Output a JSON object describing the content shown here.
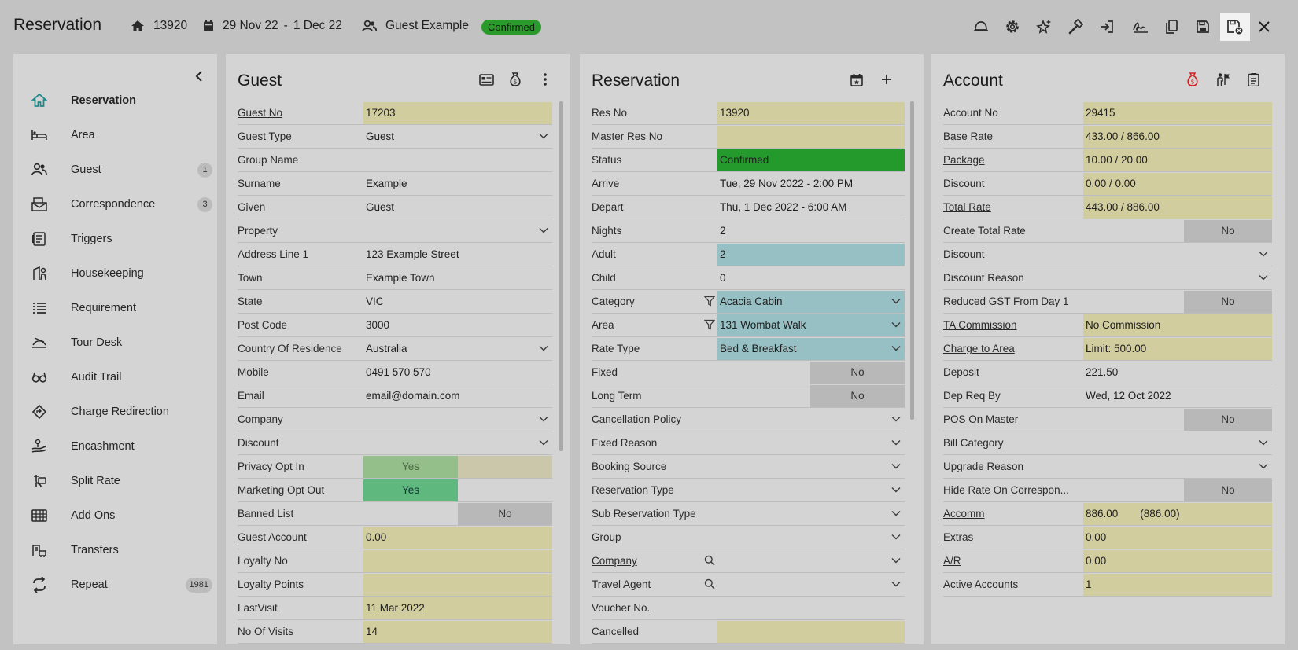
{
  "header": {
    "title": "Reservation",
    "res_no": "13920",
    "date_from": "29 Nov 22",
    "date_sep": "-",
    "date_to": "1 Dec 22",
    "guest_name": "Guest Example",
    "status": "Confirmed"
  },
  "toolbar_icons": [
    "bell-icon",
    "settings-icon",
    "magic-icon",
    "hammer-icon",
    "check-in-icon",
    "signature-icon",
    "copy-icon",
    "save-icon",
    "save-close-icon",
    "close-icon"
  ],
  "sidebar": {
    "items": [
      {
        "label": "Reservation",
        "icon": "home-icon",
        "active": true
      },
      {
        "label": "Area",
        "icon": "bed-icon"
      },
      {
        "label": "Guest",
        "icon": "people-icon",
        "count": "1"
      },
      {
        "label": "Correspondence",
        "icon": "correspondence-icon",
        "count": "3"
      },
      {
        "label": "Triggers",
        "icon": "triggers-icon"
      },
      {
        "label": "Housekeeping",
        "icon": "housekeeping-icon"
      },
      {
        "label": "Requirement",
        "icon": "list-icon"
      },
      {
        "label": "Tour Desk",
        "icon": "tour-icon"
      },
      {
        "label": "Audit Trail",
        "icon": "glasses-icon"
      },
      {
        "label": "Charge Redirection",
        "icon": "redirect-icon"
      },
      {
        "label": "Encashment",
        "icon": "encashment-icon"
      },
      {
        "label": "Split Rate",
        "icon": "split-icon"
      },
      {
        "label": "Add Ons",
        "icon": "addons-icon"
      },
      {
        "label": "Transfers",
        "icon": "transfers-icon"
      },
      {
        "label": "Repeat",
        "icon": "repeat-icon",
        "count": "1981"
      }
    ]
  },
  "guest_panel": {
    "title": "Guest",
    "rows": [
      {
        "label": "Guest No",
        "value": "17203",
        "link": true,
        "bg": "y"
      },
      {
        "label": "Guest Type",
        "value": "Guest",
        "dropdown": true
      },
      {
        "label": "Group Name",
        "value": ""
      },
      {
        "label": "Surname",
        "value": "Example"
      },
      {
        "label": "Given",
        "value": "Guest"
      },
      {
        "label": "Property",
        "value": "",
        "dropdown": true
      },
      {
        "label": "Address Line 1",
        "value": "123 Example Street"
      },
      {
        "label": "Town",
        "value": "Example Town"
      },
      {
        "label": "State",
        "value": "VIC"
      },
      {
        "label": "Post Code",
        "value": "3000"
      },
      {
        "label": "Country Of Residence",
        "value": "Australia",
        "dropdown": true
      },
      {
        "label": "Mobile",
        "value": "0491 570 570"
      },
      {
        "label": "Email",
        "value": "email@domain.com"
      },
      {
        "label": "Company",
        "value": "",
        "link": true,
        "dropdown": true
      },
      {
        "label": "Discount",
        "value": "",
        "dropdown": true
      },
      {
        "label": "Privacy Opt In",
        "value": "Yes",
        "yes": "1"
      },
      {
        "label": "Marketing Opt Out",
        "value": "Yes",
        "yes": "2"
      },
      {
        "label": "Banned List",
        "value": "No",
        "toggle": true
      },
      {
        "label": "Guest Account",
        "value": "0.00",
        "link": true,
        "bg": "y"
      },
      {
        "label": "Loyalty No",
        "value": "",
        "bg": "y"
      },
      {
        "label": "Loyalty Points",
        "value": "",
        "bg": "y"
      },
      {
        "label": "LastVisit",
        "value": "11 Mar 2022",
        "bg": "y"
      },
      {
        "label": "No Of Visits",
        "value": "14",
        "bg": "y"
      }
    ]
  },
  "reservation_panel": {
    "title": "Reservation",
    "rows": [
      {
        "label": "Res No",
        "value": "13920",
        "bg": "y"
      },
      {
        "label": "Master Res No",
        "value": "",
        "bg": "y"
      },
      {
        "label": "Status",
        "value": "Confirmed",
        "bg": "g"
      },
      {
        "label": "Arrive",
        "value": "Tue, 29 Nov 2022 - 2:00 PM"
      },
      {
        "label": "Depart",
        "value": "Thu, 1 Dec 2022 - 6:00 AM"
      },
      {
        "label": "Nights",
        "value": "2"
      },
      {
        "label": "Adult",
        "value": "2",
        "bg": "b"
      },
      {
        "label": "Child",
        "value": "0"
      },
      {
        "label": "Category",
        "value": "Acacia Cabin",
        "bg": "b",
        "dropdown": true,
        "filter": true
      },
      {
        "label": "Area",
        "value": "131 Wombat Walk",
        "bg": "b",
        "dropdown": true,
        "filter": true
      },
      {
        "label": "Rate Type",
        "value": "Bed & Breakfast",
        "bg": "b",
        "dropdown": true
      },
      {
        "label": "Fixed",
        "value": "No",
        "toggle": true
      },
      {
        "label": "Long Term",
        "value": "No",
        "toggle": true
      },
      {
        "label": "Cancellation Policy",
        "value": "",
        "dropdown": true
      },
      {
        "label": "Fixed Reason",
        "value": "",
        "dropdown": true
      },
      {
        "label": "Booking Source",
        "value": "",
        "dropdown": true
      },
      {
        "label": "Reservation Type",
        "value": "",
        "dropdown": true
      },
      {
        "label": "Sub Reservation Type",
        "value": "",
        "dropdown": true
      },
      {
        "label": "Group",
        "value": "",
        "link": true,
        "dropdown": true
      },
      {
        "label": "Company",
        "value": "",
        "link": true,
        "dropdown": true,
        "search": true
      },
      {
        "label": "Travel Agent",
        "value": "",
        "link": true,
        "dropdown": true,
        "search": true
      },
      {
        "label": "Voucher No.",
        "value": ""
      },
      {
        "label": "Cancelled",
        "value": "",
        "bg": "y"
      }
    ]
  },
  "account_panel": {
    "title": "Account",
    "rows": [
      {
        "label": "Account No",
        "value": "29415",
        "bg": "y"
      },
      {
        "label": "Base Rate",
        "value": "433.00 / 866.00",
        "link": true,
        "bg": "y"
      },
      {
        "label": "Package",
        "value": "10.00 / 20.00",
        "link": true,
        "bg": "y"
      },
      {
        "label": "Discount",
        "value": "0.00 / 0.00",
        "bg": "y"
      },
      {
        "label": "Total Rate",
        "value": "443.00 / 886.00",
        "link": true,
        "bg": "y"
      },
      {
        "label": "Create Total Rate",
        "value": "No",
        "toggle": true
      },
      {
        "label": "Discount",
        "value": "",
        "link": true,
        "dropdown": true
      },
      {
        "label": "Discount Reason",
        "value": "",
        "dropdown": true
      },
      {
        "label": "Reduced GST From Day 1",
        "value": "No",
        "toggle": true
      },
      {
        "label": "TA Commission",
        "value": "No Commission",
        "link": true,
        "bg": "y"
      },
      {
        "label": "Charge to Area",
        "value": "Limit: 500.00",
        "link": true,
        "bg": "y"
      },
      {
        "label": "Deposit",
        "value": "221.50"
      },
      {
        "label": "Dep Req By",
        "value": "Wed, 12 Oct 2022"
      },
      {
        "label": "POS On Master",
        "value": "No",
        "toggle": true
      },
      {
        "label": "Bill Category",
        "value": "",
        "dropdown": true
      },
      {
        "label": "Upgrade Reason",
        "value": "",
        "dropdown": true
      },
      {
        "label": "Hide Rate On Correspon...",
        "value": "No",
        "toggle": true
      },
      {
        "label": "Accomm",
        "value": "886.00",
        "value2": "(886.00)",
        "link": true,
        "bg": "y"
      },
      {
        "label": "Extras",
        "value": "0.00",
        "link": true,
        "bg": "y"
      },
      {
        "label": "A/R",
        "value": "0.00",
        "link": true,
        "bg": "y"
      },
      {
        "label": "Active Accounts",
        "value": "1",
        "link": true,
        "bg": "y"
      }
    ]
  }
}
